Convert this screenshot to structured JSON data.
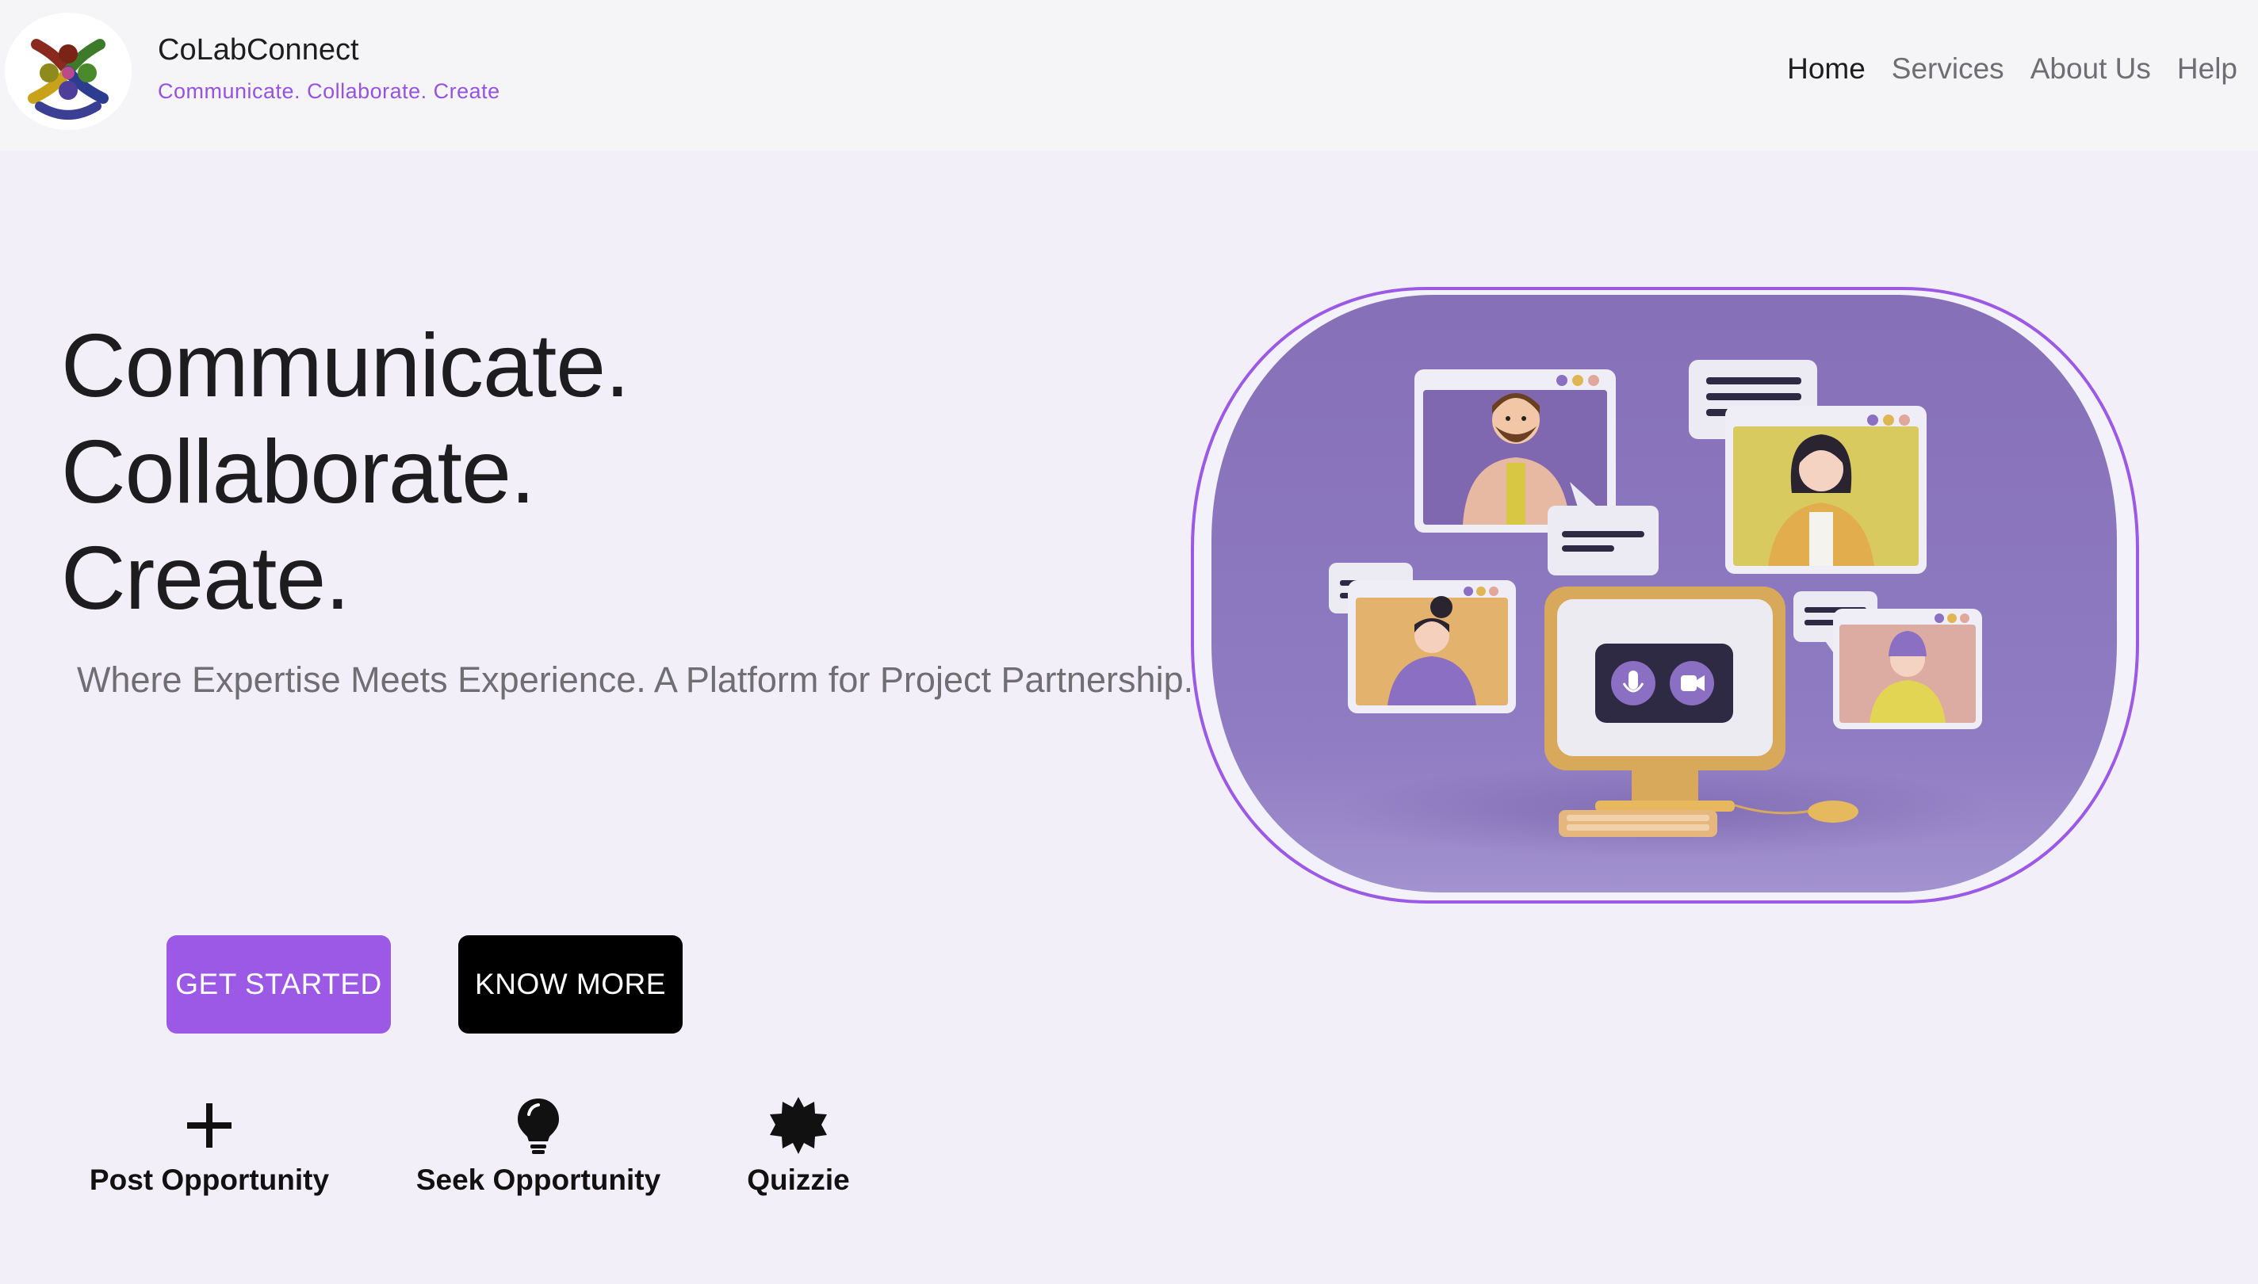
{
  "header": {
    "brand_name": "CoLabConnect",
    "tagline": "Communicate. Collaborate. Create",
    "nav": [
      {
        "label": "Home",
        "active": true
      },
      {
        "label": "Services",
        "active": false
      },
      {
        "label": "About Us",
        "active": false
      },
      {
        "label": "Help",
        "active": false
      }
    ]
  },
  "hero": {
    "lines": [
      "Communicate.",
      "Collaborate.",
      "Create."
    ],
    "subtitle": "Where Expertise Meets Experience. A Platform for Project Partnership."
  },
  "buttons": {
    "get_started": "GET STARTED",
    "know_more": "KNOW MORE"
  },
  "features": [
    {
      "icon": "plus-icon",
      "label": "Post Opportunity"
    },
    {
      "icon": "lightbulb-icon",
      "label": "Seek Opportunity"
    },
    {
      "icon": "badge-icon",
      "label": "Quizzie"
    }
  ],
  "icons": {
    "illustration": "video-conference-illustration",
    "mic": "microphone-icon",
    "camera": "video-camera-icon"
  },
  "colors": {
    "accent": "#9b59e6",
    "tagline": "#9553e0",
    "page_bg": "#f2eff9",
    "header_bg": "#f5f5f7",
    "illustration_bg": "#8a74bd",
    "text_dark": "#1d1d1f",
    "text_muted": "#6e6e73"
  }
}
